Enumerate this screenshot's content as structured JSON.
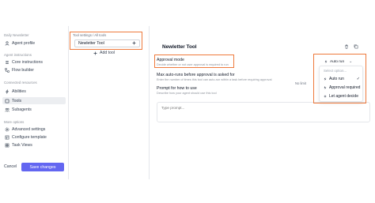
{
  "sidebar": {
    "agent_name": "Daily Newsletter",
    "agent_profile": "Agent profile",
    "sections": {
      "instructions": "Agent instructions",
      "connected": "Connected resources",
      "more": "More options"
    },
    "items": {
      "core_instructions": "Core instructions",
      "flow_builder": "Flow builder",
      "abilities": "Abilities",
      "tools": "Tools",
      "subagents": "Subagents",
      "advanced_settings": "Advanced settings",
      "configure_template": "Configure template",
      "task_views": "Task Views"
    },
    "cancel_label": "Cancel",
    "save_label": "Save changes"
  },
  "tools_column": {
    "breadcrumb_parent": "Tool settings",
    "breadcrumb_sep": "/",
    "breadcrumb_current": "All tools",
    "selected_tool": "Newletter Tool",
    "add_tool_label": "Add tool"
  },
  "panel": {
    "title": "Newletter Tool",
    "approval_mode": {
      "title": "Approval mode",
      "description": "Decide whether or not user approval is required to run"
    },
    "max_auto_runs": {
      "title": "Max auto-runs before approval is asked for",
      "description": "Enter the number of times this tool can auto-run within a task before requiring approval",
      "value": "No limit"
    },
    "prompt": {
      "title": "Prompt for how to use",
      "description": "Describe how your agent should use this tool",
      "placeholder": "Type prompt..."
    },
    "select": {
      "selected": "Auto run",
      "placeholder": "Select option...",
      "options": [
        "Auto run",
        "Approval required",
        "Let agent decide"
      ]
    }
  },
  "colors": {
    "accent": "#6366f1",
    "highlight": "#ee7a3c"
  }
}
